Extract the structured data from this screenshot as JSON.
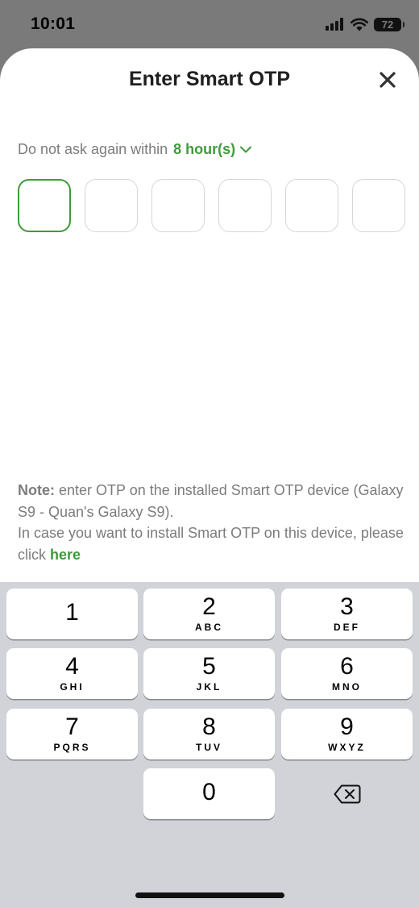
{
  "status": {
    "time": "10:01",
    "battery": "72",
    "signal_icon": "cellular-signal-icon",
    "wifi_icon": "wifi-icon"
  },
  "sheet": {
    "title": "Enter Smart OTP",
    "close_icon": "close-icon",
    "ask_again_prefix": "Do not ask again within",
    "ask_again_value": "8 hour(s)",
    "otp_boxes": 6,
    "accent_color": "#3f9a3c"
  },
  "note": {
    "label": "Note:",
    "line1": " enter OTP on the installed Smart OTP device (Galaxy S9 - Quan's Galaxy S9).",
    "line2": "In case you want to install Smart OTP on this device, please click ",
    "link": "here"
  },
  "keypad": {
    "keys": [
      {
        "digit": "1",
        "letters": ""
      },
      {
        "digit": "2",
        "letters": "ABC"
      },
      {
        "digit": "3",
        "letters": "DEF"
      },
      {
        "digit": "4",
        "letters": "GHI"
      },
      {
        "digit": "5",
        "letters": "JKL"
      },
      {
        "digit": "6",
        "letters": "MNO"
      },
      {
        "digit": "7",
        "letters": "PQRS"
      },
      {
        "digit": "8",
        "letters": "TUV"
      },
      {
        "digit": "9",
        "letters": "WXYZ"
      },
      {
        "digit": "0",
        "letters": ""
      }
    ],
    "backspace_icon": "backspace-icon"
  }
}
